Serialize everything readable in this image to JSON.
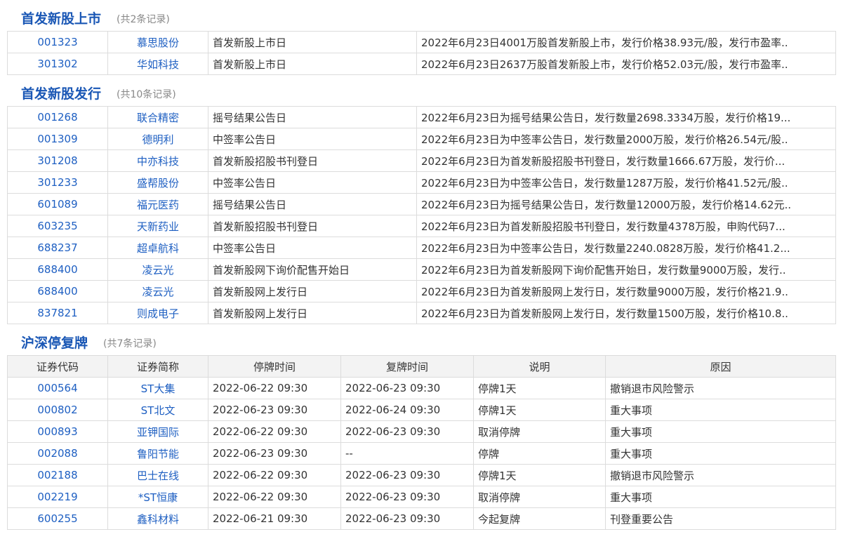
{
  "listing": {
    "title": "首发新股上市",
    "count": "(共2条记录)",
    "rows": [
      {
        "code": "001323",
        "name": "慕思股份",
        "type": "首发新股上市日",
        "desc": "2022年6月23日4001万股首发新股上市，发行价格38.93元/股，发行市盈率.."
      },
      {
        "code": "301302",
        "name": "华如科技",
        "type": "首发新股上市日",
        "desc": "2022年6月23日2637万股首发新股上市，发行价格52.03元/股，发行市盈率.."
      }
    ]
  },
  "issuance": {
    "title": "首发新股发行",
    "count": "(共10条记录)",
    "rows": [
      {
        "code": "001268",
        "name": "联合精密",
        "type": "摇号结果公告日",
        "desc": "2022年6月23日为摇号结果公告日，发行数量2698.3334万股，发行价格19..."
      },
      {
        "code": "001309",
        "name": "德明利",
        "type": "中签率公告日",
        "desc": "2022年6月23日为中签率公告日，发行数量2000万股，发行价格26.54元/股.."
      },
      {
        "code": "301208",
        "name": "中亦科技",
        "type": "首发新股招股书刊登日",
        "desc": "2022年6月23日为首发新股招股书刊登日，发行数量1666.67万股，发行价..."
      },
      {
        "code": "301233",
        "name": "盛帮股份",
        "type": "中签率公告日",
        "desc": "2022年6月23日为中签率公告日，发行数量1287万股，发行价格41.52元/股.."
      },
      {
        "code": "601089",
        "name": "福元医药",
        "type": "摇号结果公告日",
        "desc": "2022年6月23日为摇号结果公告日，发行数量12000万股，发行价格14.62元.."
      },
      {
        "code": "603235",
        "name": "天新药业",
        "type": "首发新股招股书刊登日",
        "desc": "2022年6月23日为首发新股招股书刊登日，发行数量4378万股，申购代码7..."
      },
      {
        "code": "688237",
        "name": "超卓航科",
        "type": "中签率公告日",
        "desc": "2022年6月23日为中签率公告日，发行数量2240.0828万股，发行价格41.2..."
      },
      {
        "code": "688400",
        "name": "凌云光",
        "type": "首发新股网下询价配售开始日",
        "desc": "2022年6月23日为首发新股网下询价配售开始日，发行数量9000万股，发行.."
      },
      {
        "code": "688400",
        "name": "凌云光",
        "type": "首发新股网上发行日",
        "desc": "2022年6月23日为首发新股网上发行日，发行数量9000万股，发行价格21.9.."
      },
      {
        "code": "837821",
        "name": "则成电子",
        "type": "首发新股网上发行日",
        "desc": "2022年6月23日为首发新股网上发行日，发行数量1500万股，发行价格10.8.."
      }
    ]
  },
  "suspension": {
    "title": "沪深停复牌",
    "count": "(共7条记录)",
    "headers": [
      "证券代码",
      "证券简称",
      "停牌时间",
      "复牌时间",
      "说明",
      "原因"
    ],
    "rows": [
      {
        "code": "000564",
        "name": "ST大集",
        "stop": "2022-06-22 09:30",
        "resume": "2022-06-23 09:30",
        "note": "停牌1天",
        "reason": "撤销退市风险警示"
      },
      {
        "code": "000802",
        "name": "ST北文",
        "stop": "2022-06-23 09:30",
        "resume": "2022-06-24 09:30",
        "note": "停牌1天",
        "reason": "重大事项"
      },
      {
        "code": "000893",
        "name": "亚钾国际",
        "stop": "2022-06-22 09:30",
        "resume": "2022-06-23 09:30",
        "note": "取消停牌",
        "reason": "重大事项"
      },
      {
        "code": "002088",
        "name": "鲁阳节能",
        "stop": "2022-06-23 09:30",
        "resume": "--",
        "note": "停牌",
        "reason": "重大事项"
      },
      {
        "code": "002188",
        "name": "巴士在线",
        "stop": "2022-06-22 09:30",
        "resume": "2022-06-23 09:30",
        "note": "停牌1天",
        "reason": "撤销退市风险警示"
      },
      {
        "code": "002219",
        "name": "*ST恒康",
        "stop": "2022-06-22 09:30",
        "resume": "2022-06-23 09:30",
        "note": "取消停牌",
        "reason": "重大事项"
      },
      {
        "code": "600255",
        "name": "鑫科材料",
        "stop": "2022-06-21 09:30",
        "resume": "2022-06-23 09:30",
        "note": "今起复牌",
        "reason": "刊登重要公告"
      }
    ]
  }
}
